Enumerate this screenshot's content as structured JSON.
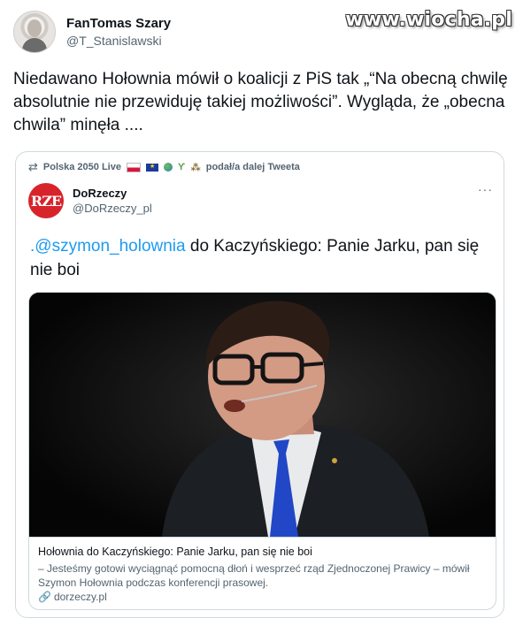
{
  "watermark": "www.wiocha.pl",
  "author": {
    "display_name": "FanTomas Szary",
    "handle": "@T_Stanislawski"
  },
  "tweet": {
    "text": "Niedawano Hołownia mówił o koalicji z PiS tak „“Na obecną chwilę absolutnie nie przewiduję takiej możliwości”.  Wygląda, że „obecna chwila” minęła ...."
  },
  "quote": {
    "retweet_by": "Polska 2050 Live",
    "retweet_action": "podał/a dalej Tweeta",
    "author": {
      "display_name": "DoRzeczy",
      "handle": "@DoRzeczy_pl",
      "avatar_text": "RZE"
    },
    "mention": ".@szymon_holownia",
    "text": " do Kaczyńskiego: Panie Jarku, pan się nie boi",
    "more_label": "···",
    "card": {
      "title": "Hołownia do Kaczyńskiego: Panie Jarku, pan się nie boi",
      "description": "– Jesteśmy gotowi wyciągnąć pomocną dłoń i wesprzeć rząd Zjednoczonej Prawicy – mówił Szymon Hołownia podczas konferencji prasowej.",
      "domain": "dorzeczy.pl"
    }
  },
  "colors": {
    "link": "#1d9bf0",
    "secondary_text": "#536471",
    "brand_red": "#d7242b",
    "tie_blue": "#2147c7"
  },
  "icons": {
    "retweet": "retweet-icon",
    "more": "more-icon",
    "link": "link-icon"
  }
}
